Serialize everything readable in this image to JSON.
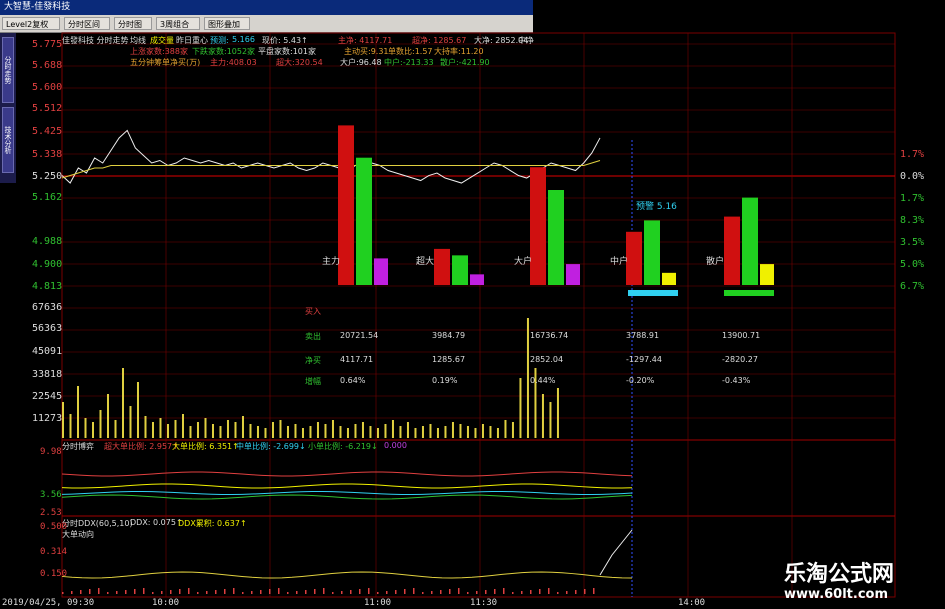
{
  "window": {
    "title": "大智慧-佳發科技"
  },
  "toolbar": {
    "items": [
      "Level2复权",
      "分时区间",
      "分时图",
      "3周组合",
      "图形叠加"
    ]
  },
  "left_tabs": [
    "分时走势",
    "技术分析"
  ],
  "header": {
    "stock_line": "佳發科技 分时走势",
    "legend": {
      "avg": "均线",
      "volume": "成交量",
      "prev": "昨日重心",
      "expect_label": "预测:",
      "expect": "5.166"
    },
    "price_line": "现价: 5.43↑",
    "main_label": "主净: 4117.71",
    "super_label": "超净: 1285.67",
    "big_label": "大净: 2852.04",
    "mid_abbr": "中净",
    "row2": {
      "up": "上涨家数:388家",
      "down": "下跌家数:1052家",
      "flat": "平盘家数:101家",
      "active": "主动买:9.31",
      "ratio": "单数比:1.57",
      "hold": "大持率:11.20"
    },
    "row3": {
      "label": "五分钟筹单净买(万)",
      "main": "主力:408.03",
      "super": "超大:320.54",
      "big": "大户:96.48",
      "mid": "中户:-213.33",
      "retail": "散户:-421.90"
    }
  },
  "price_axis": [
    "5.775",
    "5.688",
    "5.600",
    "5.512",
    "5.425",
    "5.338",
    "5.250",
    "5.162",
    "4.988",
    "4.900",
    "4.813"
  ],
  "volume_axis": [
    "67636",
    "56363",
    "45091",
    "33818",
    "22545",
    "11273"
  ],
  "pct_axis": [
    "1.7%",
    "0.0%",
    "1.7%",
    "3.5%",
    "5.0%",
    "6.7%",
    "8.3%"
  ],
  "colors": {
    "up": "#d01010",
    "down": "#20d020",
    "purple": "#c020e0",
    "yellow": "#f0f000",
    "cyan": "#30d0f0",
    "grid": "#7a0000"
  },
  "flow_groups": [
    {
      "label": "主力",
      "buy": 4.2,
      "sell": 3.35,
      "net": 0.7
    },
    {
      "label": "超大",
      "buy": 0.95,
      "sell": 0.78,
      "net": 0.28
    },
    {
      "label": "大户",
      "buy": 3.1,
      "sell": 2.5,
      "net": 0.55
    },
    {
      "label": "中户",
      "buy": 1.4,
      "sell": 1.7,
      "net": 0.32
    },
    {
      "label": "散户",
      "buy": 1.8,
      "sell": 2.3,
      "net": 0.55
    }
  ],
  "predict_label": "预警 5.16",
  "stats": {
    "rows": [
      "买入",
      "卖出",
      "净买",
      "增幅"
    ],
    "cols": [
      [
        "",
        "20721.54",
        "4117.71",
        "0.64%"
      ],
      [
        "",
        "3984.79",
        "1285.67",
        "0.19%"
      ],
      [
        "",
        "16736.74",
        "2852.04",
        "0.44%"
      ],
      [
        "",
        "3788.91",
        "-1297.44",
        "-0.20%"
      ],
      [
        "",
        "13900.71",
        "-2820.27",
        "-0.43%"
      ]
    ]
  },
  "panel2": {
    "title": "分时博弈",
    "s1": "超大单比例: 2.957↑",
    "s2": "大单比例: 6.351↑",
    "s3": "中单比例: -2.699↓",
    "s4": "小单比例: -6.219↓",
    "s5": "0.000",
    "y_top": "9.98",
    "y_mid": "3.56",
    "y_low": "2.53"
  },
  "panel3": {
    "title": "分时DDX(60,5,10)",
    "ddx": "DDX: 0.075↑",
    "ddy": "DDX累积: 0.637↑",
    "sub": "大单动向",
    "y_top": "0.500",
    "y_mid": "0.314",
    "y_low": "0.150"
  },
  "time_axis": [
    "2019/04/25, 09:30",
    "10:00",
    "11:00",
    "11:30",
    "14:00"
  ],
  "price_line": [
    5.25,
    5.22,
    5.28,
    5.26,
    5.32,
    5.3,
    5.35,
    5.4,
    5.43,
    5.36,
    5.33,
    5.3,
    5.31,
    5.29,
    5.3,
    5.32,
    5.31,
    5.3,
    5.31,
    5.3,
    5.29,
    5.3,
    5.28,
    5.29,
    5.3,
    5.29,
    5.28,
    5.29,
    5.3,
    5.28,
    5.27,
    5.28,
    5.3,
    5.29,
    5.28,
    5.27,
    5.29,
    5.31,
    5.3,
    5.29,
    5.27,
    5.26,
    5.25,
    5.24,
    5.23,
    5.25,
    5.26,
    5.24,
    5.23,
    5.22,
    5.24,
    5.26,
    5.28,
    5.3,
    5.29,
    5.27,
    5.25,
    5.24,
    5.26,
    5.28,
    5.3,
    5.29,
    5.28,
    5.27,
    5.3,
    5.34,
    5.4
  ],
  "avg_line": [
    5.24,
    5.25,
    5.26,
    5.27,
    5.28,
    5.28,
    5.29,
    5.29,
    5.29,
    5.29,
    5.29,
    5.29,
    5.29,
    5.29,
    5.29,
    5.29,
    5.29,
    5.29,
    5.29,
    5.29,
    5.29,
    5.29,
    5.29,
    5.29,
    5.29,
    5.29,
    5.29,
    5.29,
    5.29,
    5.29,
    5.29,
    5.29,
    5.29,
    5.29,
    5.29,
    5.29,
    5.29,
    5.29,
    5.29,
    5.29,
    5.29,
    5.29,
    5.29,
    5.29,
    5.29,
    5.29,
    5.29,
    5.29,
    5.29,
    5.29,
    5.29,
    5.29,
    5.29,
    5.29,
    5.29,
    5.29,
    5.29,
    5.29,
    5.29,
    5.29,
    5.29,
    5.29,
    5.29,
    5.29,
    5.29,
    5.3,
    5.31
  ],
  "volumes": [
    18,
    12,
    26,
    10,
    8,
    14,
    22,
    9,
    35,
    16,
    28,
    11,
    8,
    10,
    7,
    9,
    12,
    6,
    8,
    10,
    7,
    6,
    9,
    8,
    11,
    7,
    6,
    5,
    8,
    9,
    6,
    7,
    5,
    6,
    8,
    7,
    9,
    6,
    5,
    7,
    8,
    6,
    5,
    7,
    9,
    6,
    8,
    5,
    6,
    7,
    5,
    6,
    8,
    7,
    6,
    5,
    7,
    6,
    5,
    9,
    8,
    30,
    60,
    35,
    22,
    18,
    25
  ]
}
